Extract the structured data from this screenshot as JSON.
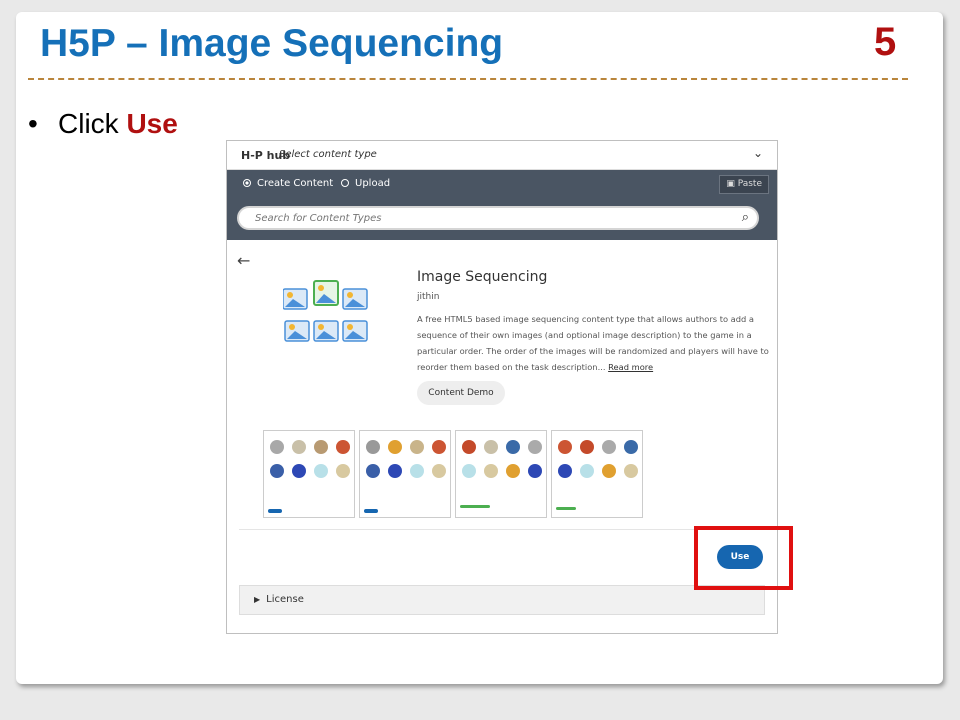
{
  "slide": {
    "title": "H5P – Image Sequencing",
    "number": "5",
    "bullet_symbol": "•",
    "bullet_text": "Click ",
    "bullet_emphasis": "Use"
  },
  "hub": {
    "logo": "H-P hub",
    "select_label": "Select content type",
    "chevron": "chevron-down-icon",
    "tab_create": "Create Content",
    "tab_upload": "Upload",
    "paste_label": "Paste",
    "search_placeholder": "Search for Content Types"
  },
  "content": {
    "title": "Image Sequencing",
    "author": "jithin",
    "description": "A free HTML5 based image sequencing content type that allows authors to add a sequence of their own images (and optional image description) to the game in a particular order. The order of the images will be randomized and players will have to reorder them based on the task description...",
    "read_more": "Read more",
    "demo_button": "Content Demo",
    "use_button": "Use",
    "license_label": "License"
  },
  "colors": {
    "title_blue": "#1570b8",
    "accent_red": "#b01010",
    "use_blue": "#1666b0",
    "highlight_red": "#e01010"
  }
}
